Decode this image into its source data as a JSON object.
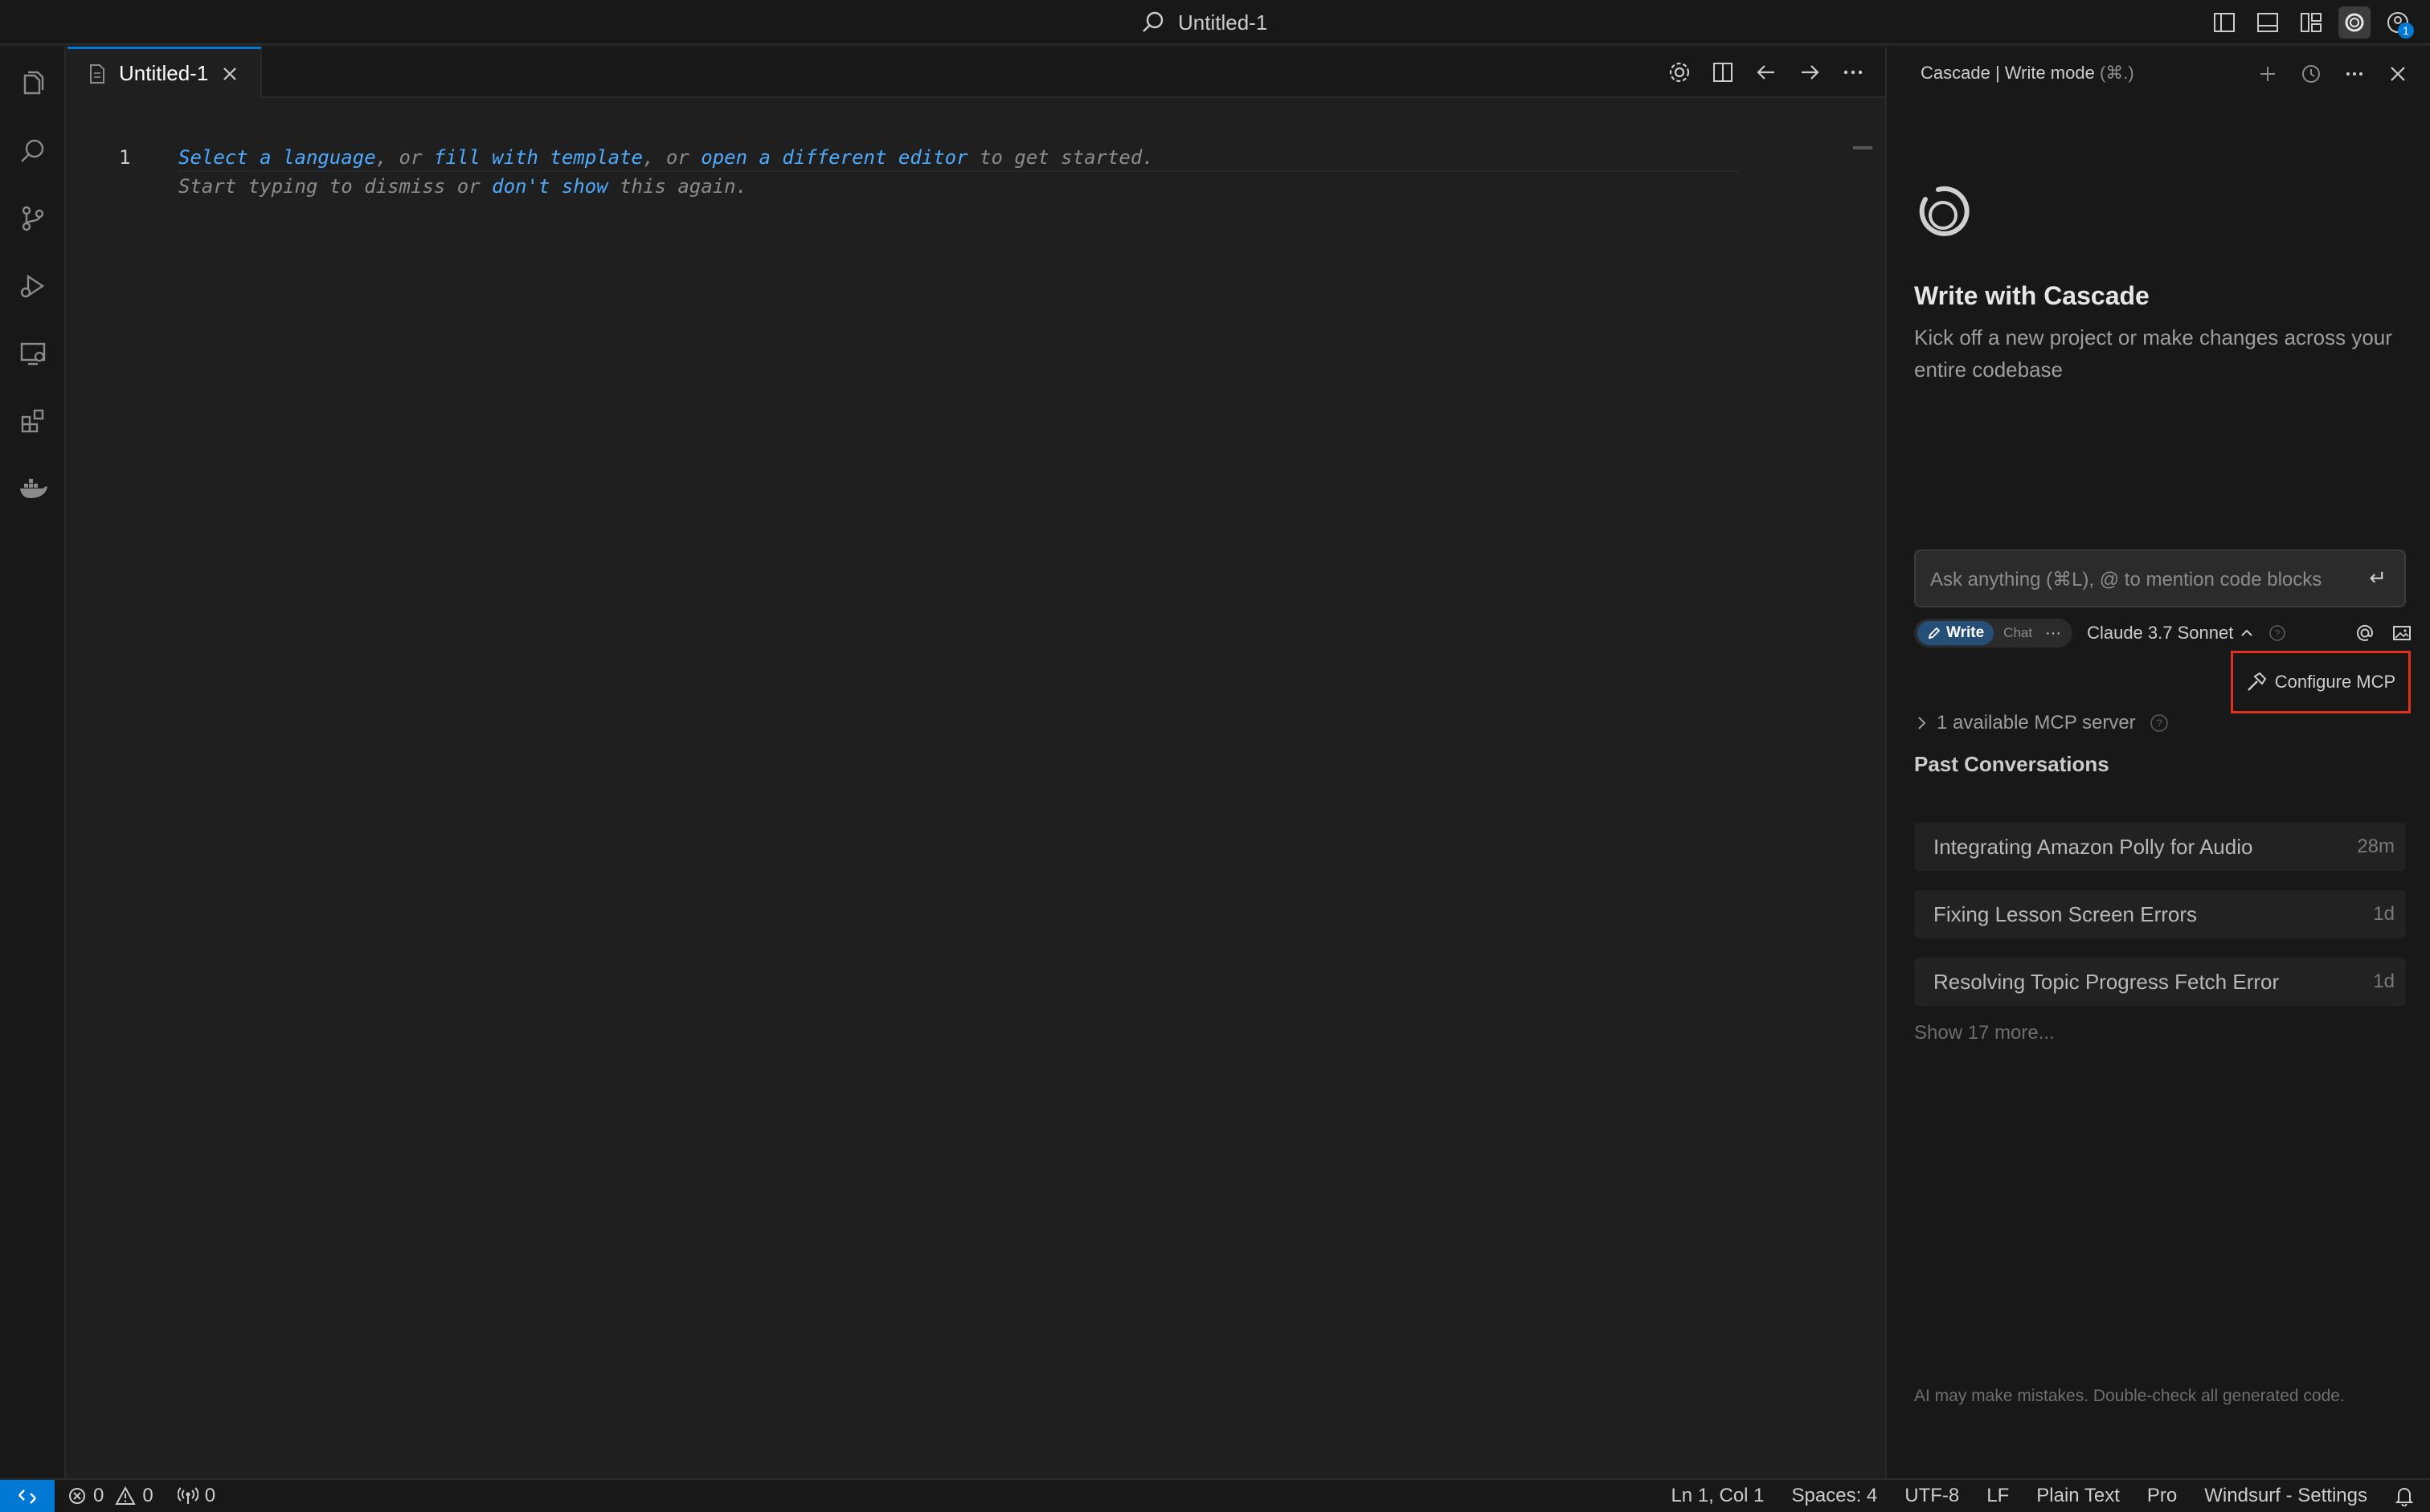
{
  "window": {
    "title": "Untitled-1"
  },
  "editor": {
    "tab_label": "Untitled-1",
    "line_number": "1",
    "hint_line1": {
      "select_language": "Select a language",
      "sep1": ", or ",
      "fill_template": "fill with template",
      "sep2": ", or ",
      "open_editor": "open a different editor",
      "tail": " to get started."
    },
    "hint_line2": {
      "head": "Start typing to dismiss or ",
      "dont_show": "don't show",
      "tail": " this again."
    }
  },
  "cascade": {
    "header_title": "Cascade | Write mode",
    "header_shortcut": "(⌘.)",
    "hero_title": "Write with Cascade",
    "hero_subtitle": "Kick off a new project or make changes across your entire codebase",
    "ask_placeholder": "Ask anything (⌘L), @ to mention code blocks",
    "mode_write": "Write",
    "mode_chat": "Chat",
    "model_name": "Claude 3.7 Sonnet",
    "mcp_available": "1 available MCP server",
    "configure_mcp": "Configure MCP",
    "past_title": "Past Conversations",
    "conversations": [
      {
        "title": "Integrating Amazon Polly for Audio",
        "age": "28m"
      },
      {
        "title": "Fixing Lesson Screen Errors",
        "age": "1d"
      },
      {
        "title": "Resolving Topic Progress Fetch Error",
        "age": "1d"
      }
    ],
    "show_more": "Show 17 more...",
    "disclaimer": "AI may make mistakes. Double-check all generated code."
  },
  "status_bar": {
    "errors": "0",
    "warnings": "0",
    "ports": "0",
    "position": "Ln 1, Col 1",
    "spaces": "Spaces: 4",
    "encoding": "UTF-8",
    "eol": "LF",
    "language": "Plain Text",
    "plan": "Pro",
    "settings": "Windsurf - Settings"
  },
  "notifications": {
    "badge_count": "1"
  },
  "colors": {
    "accent": "#0078d4",
    "highlight_border": "#e0301e",
    "link": "#4daafc"
  }
}
